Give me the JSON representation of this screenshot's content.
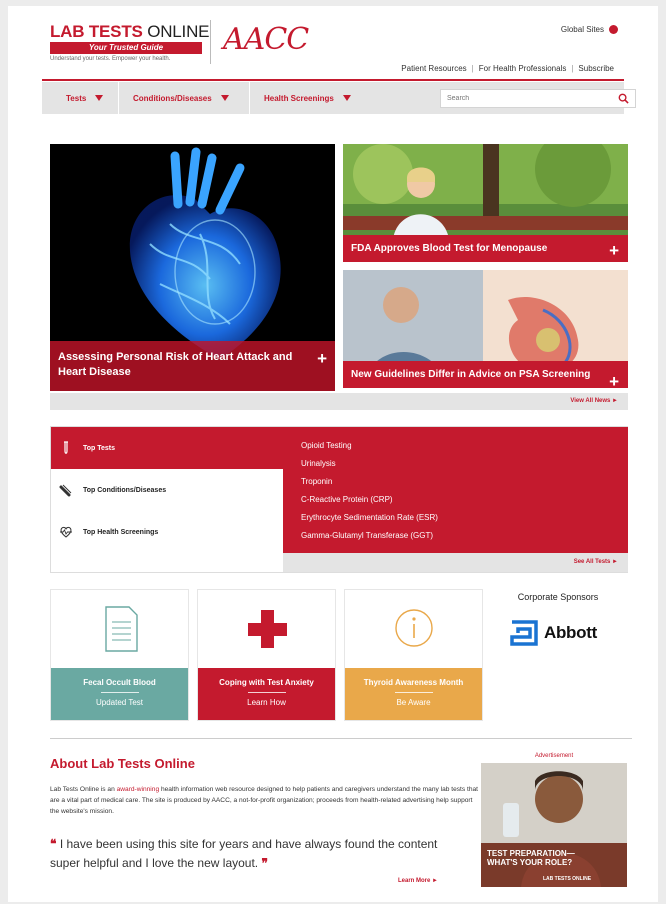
{
  "header": {
    "logo_main": "LAB TESTS",
    "logo_online": "ONLINE",
    "logo_tagline_bar": "Your Trusted Guide",
    "logo_tagline": "Understand your tests. Empower your health.",
    "org_logo": "AACC",
    "global_sites": "Global Sites",
    "top_links": [
      "Patient Resources",
      "For Health Professionals",
      "Subscribe"
    ]
  },
  "nav": {
    "items": [
      "Tests",
      "Conditions/Diseases",
      "Health Screenings"
    ],
    "search_placeholder": "Search"
  },
  "hero": {
    "main_caption": "Assessing Personal Risk of Heart Attack and Heart Disease",
    "side_stories": [
      "FDA Approves Blood Test for Menopause",
      "New Guidelines Differ in Advice on PSA Screening"
    ],
    "view_all": "View All News ►"
  },
  "tests": {
    "tabs": [
      "Top Tests",
      "Top Conditions/Diseases",
      "Top Health Screenings"
    ],
    "list": [
      "Opioid Testing",
      "Urinalysis",
      "Troponin",
      "C-Reactive Protein (CRP)",
      "Erythrocyte Sedimentation Rate (ESR)",
      "Gamma-Glutamyl Transferase (GGT)"
    ],
    "see_all": "See All Tests ►"
  },
  "cards": [
    {
      "title": "Fecal Occult Blood",
      "sub": "Updated Test",
      "color": "#6aa9a2"
    },
    {
      "title": "Coping with Test Anxiety",
      "sub": "Learn How",
      "color": "#c41a2e"
    },
    {
      "title": "Thyroid Awareness Month",
      "sub": "Be Aware",
      "color": "#e9a84a"
    }
  ],
  "sponsors": {
    "title": "Corporate Sponsors",
    "name": "Abbott"
  },
  "about": {
    "title": "About Lab Tests Online",
    "text_before": "Lab Tests Online is an ",
    "text_link": "award-winning",
    "text_after": " health information web resource designed to help patients and caregivers understand the many lab tests that are a vital part of medical care. The site is produced by AACC, a not-for-profit organization; proceeds from health-related advertising help support the website's mission.",
    "quote": "I have been using this site for years and have always found the content super helpful and I love the new layout.",
    "learn_more": "Learn More ►"
  },
  "ad": {
    "label": "Advertisement",
    "headline_1": "TEST PREPARATION—",
    "headline_2": "WHAT'S YOUR ROLE?",
    "brand": "LAB TESTS ONLINE"
  },
  "colors": {
    "brand_red": "#c41a2e",
    "nav_gray": "#e4e4e4"
  }
}
